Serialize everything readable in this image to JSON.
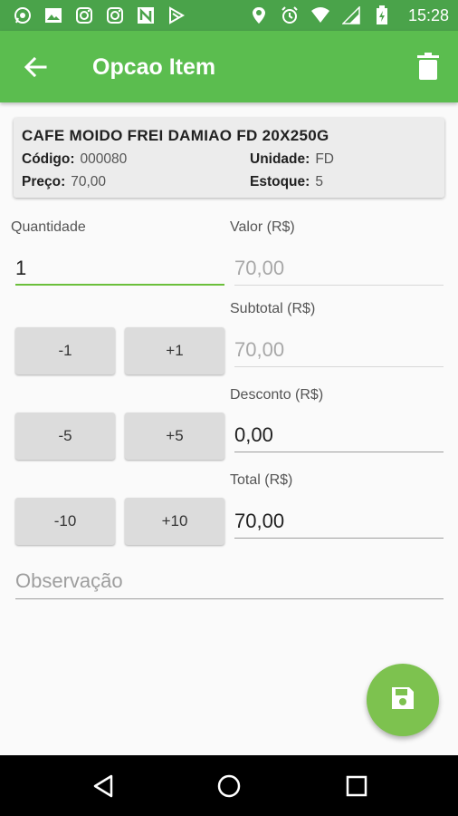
{
  "status_bar": {
    "time": "15:28",
    "left_icons": [
      "whatsapp-icon",
      "image-icon",
      "instagram-icon",
      "instagram-icon",
      "n-app-icon",
      "play-icon"
    ],
    "right_icons": [
      "location-icon",
      "alarm-icon",
      "wifi-icon",
      "signal-icon",
      "battery-charging-icon"
    ]
  },
  "app_bar": {
    "title": "Opcao Item",
    "back_icon": "arrow-left-icon",
    "delete_icon": "trash-icon",
    "color": "#5bbd4f"
  },
  "product": {
    "name": "CAFE MOIDO FREI DAMIAO FD 20X250G",
    "code_label": "Código:",
    "code": "000080",
    "unit_label": "Unidade:",
    "unit": "FD",
    "price_label": "Preço:",
    "price": "70,00",
    "stock_label": "Estoque:",
    "stock": "5"
  },
  "form": {
    "quantity_label": "Quantidade",
    "quantity": "1",
    "value_label": "Valor (R$)",
    "value": "70,00",
    "subtotal_label": "Subtotal (R$)",
    "subtotal": "70,00",
    "discount_label": "Desconto (R$)",
    "discount": "0,00",
    "total_label": "Total (R$)",
    "total": "70,00",
    "observation_placeholder": "Observação"
  },
  "buttons": {
    "minus1": "-1",
    "plus1": "+1",
    "minus5": "-5",
    "plus5": "+5",
    "minus10": "-10",
    "plus10": "+10"
  },
  "fab": {
    "icon": "save-icon",
    "color": "#7dc24f"
  },
  "nav_bar": {
    "icons": [
      "back-triangle-icon",
      "home-circle-icon",
      "recents-square-icon"
    ]
  }
}
